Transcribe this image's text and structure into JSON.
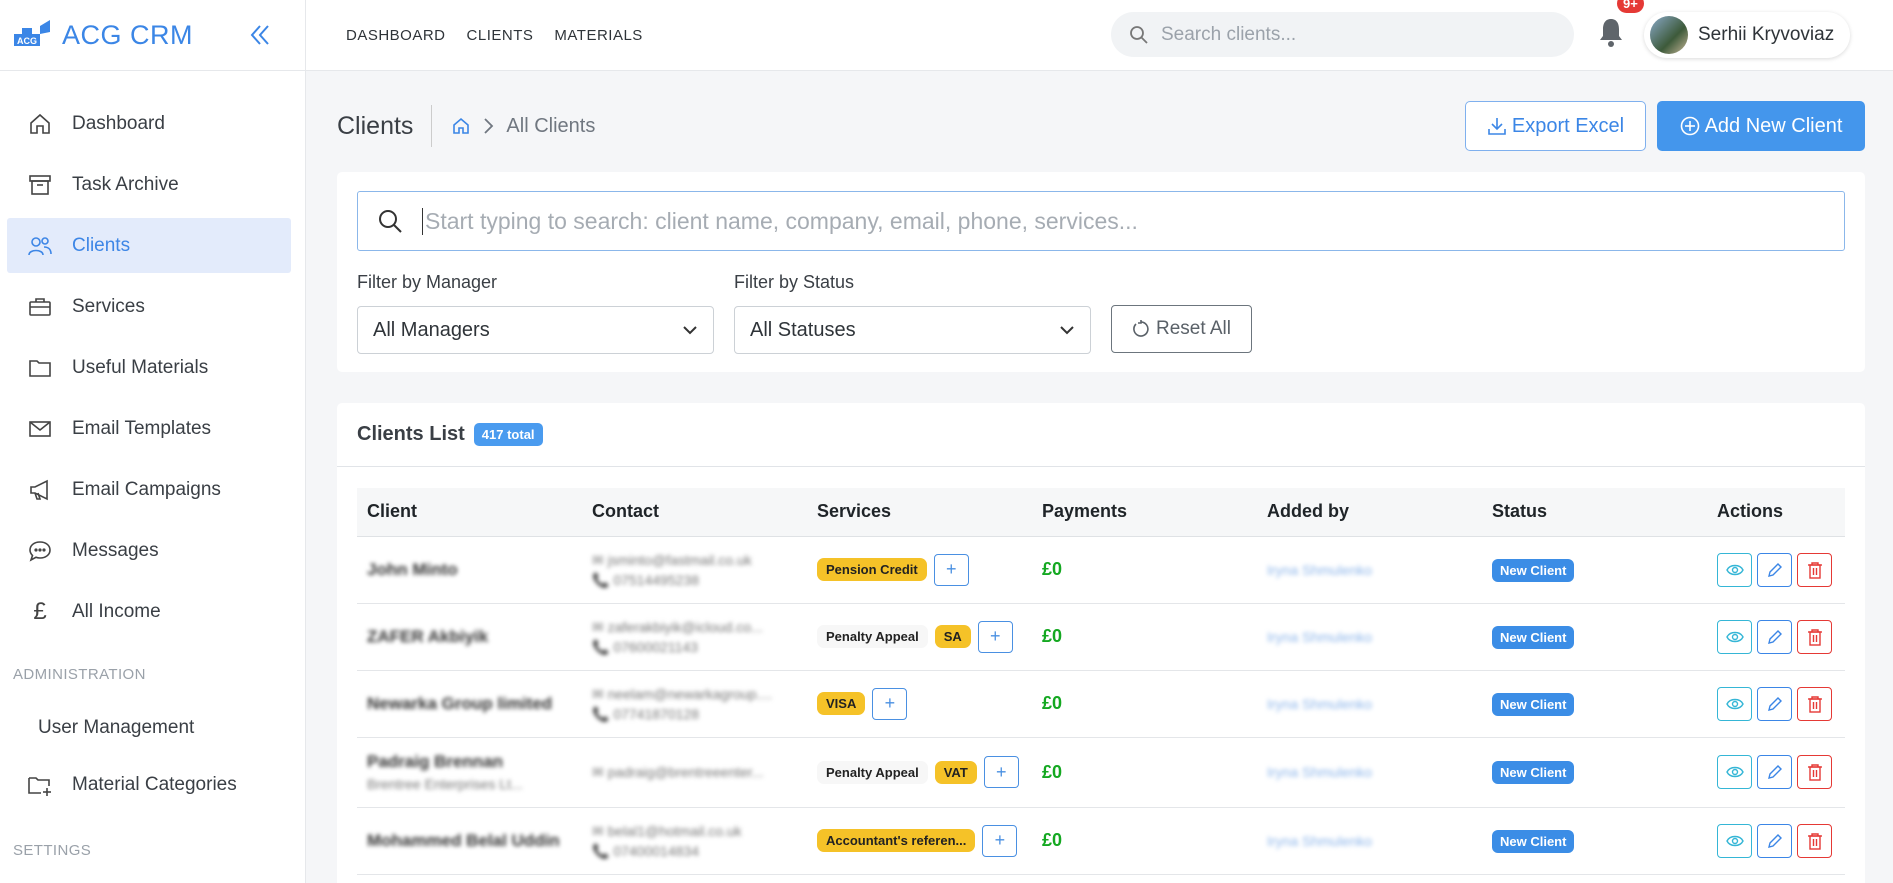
{
  "brand": {
    "name": "ACG CRM"
  },
  "topnav": [
    {
      "label": "DASHBOARD"
    },
    {
      "label": "CLIENTS"
    },
    {
      "label": "MATERIALS"
    }
  ],
  "top_search": {
    "placeholder": "Search clients..."
  },
  "notifications": {
    "badge": "9+"
  },
  "user": {
    "name": "Serhii Kryvoviaz"
  },
  "sidebar": {
    "items": [
      {
        "label": "Dashboard",
        "icon": "home-icon"
      },
      {
        "label": "Task Archive",
        "icon": "archive-icon"
      },
      {
        "label": "Clients",
        "icon": "users-icon",
        "active": true
      },
      {
        "label": "Services",
        "icon": "briefcase-icon"
      },
      {
        "label": "Useful Materials",
        "icon": "folder-icon"
      },
      {
        "label": "Email Templates",
        "icon": "envelope-icon"
      },
      {
        "label": "Email Campaigns",
        "icon": "megaphone-icon"
      },
      {
        "label": "Messages",
        "icon": "chat-icon"
      },
      {
        "label": "All Income",
        "icon": "pound-icon"
      }
    ],
    "admin_section": "ADMINISTRATION",
    "admin_items": [
      {
        "label": "User Management"
      },
      {
        "label": "Material Categories",
        "icon": "folder-plus-icon"
      }
    ],
    "settings_section": "SETTINGS"
  },
  "page": {
    "title": "Clients",
    "breadcrumb": "All Clients",
    "export_label": "Export Excel",
    "add_label": "Add New Client"
  },
  "filters": {
    "search_placeholder": "Start typing to search: client name, company, email, phone, services...",
    "manager_label": "Filter by Manager",
    "manager_value": "All Managers",
    "status_label": "Filter by Status",
    "status_value": "All Statuses",
    "reset_label": "Reset All"
  },
  "list": {
    "title": "Clients List",
    "total": "417 total",
    "columns": [
      "Client",
      "Contact",
      "Services",
      "Payments",
      "Added by",
      "Status",
      "Actions"
    ],
    "rows": [
      {
        "name": "John Minto",
        "company": "",
        "email": "jsminto@fastmail.co.uk",
        "phone": "07514495238",
        "services": [
          {
            "label": "Pension Credit",
            "style": "y"
          }
        ],
        "payment": "£0",
        "added_by": "Iryna Shmulenko",
        "status": "New Client"
      },
      {
        "name": "ZAFER Akbiyik",
        "company": "",
        "email": "zaferakbiyik@icloud.co...",
        "phone": "07600021143",
        "services": [
          {
            "label": "Penalty Appeal",
            "style": "w"
          },
          {
            "label": "SA",
            "style": "y"
          }
        ],
        "payment": "£0",
        "added_by": "Iryna Shmulenko",
        "status": "New Client"
      },
      {
        "name": "Newarka Group limited",
        "company": "",
        "email": "neelam@newarkagroup....",
        "phone": "07741870128",
        "services": [
          {
            "label": "VISA",
            "style": "y"
          }
        ],
        "payment": "£0",
        "added_by": "Iryna Shmulenko",
        "status": "New Client"
      },
      {
        "name": "Padraig Brennan",
        "company": "Brentree Enterprises Lt...",
        "email": "padraig@brentreeenter...",
        "phone": "",
        "services": [
          {
            "label": "Penalty Appeal",
            "style": "w"
          },
          {
            "label": "VAT",
            "style": "y"
          }
        ],
        "payment": "£0",
        "added_by": "Iryna Shmulenko",
        "status": "New Client"
      },
      {
        "name": "Mohammed Belal Uddin",
        "company": "",
        "email": "belal1@hotmail.co.uk",
        "phone": "07400014834",
        "services": [
          {
            "label": "Accountant's referen...",
            "style": "y"
          }
        ],
        "payment": "£0",
        "added_by": "Iryna Shmulenko",
        "status": "New Client"
      }
    ]
  }
}
